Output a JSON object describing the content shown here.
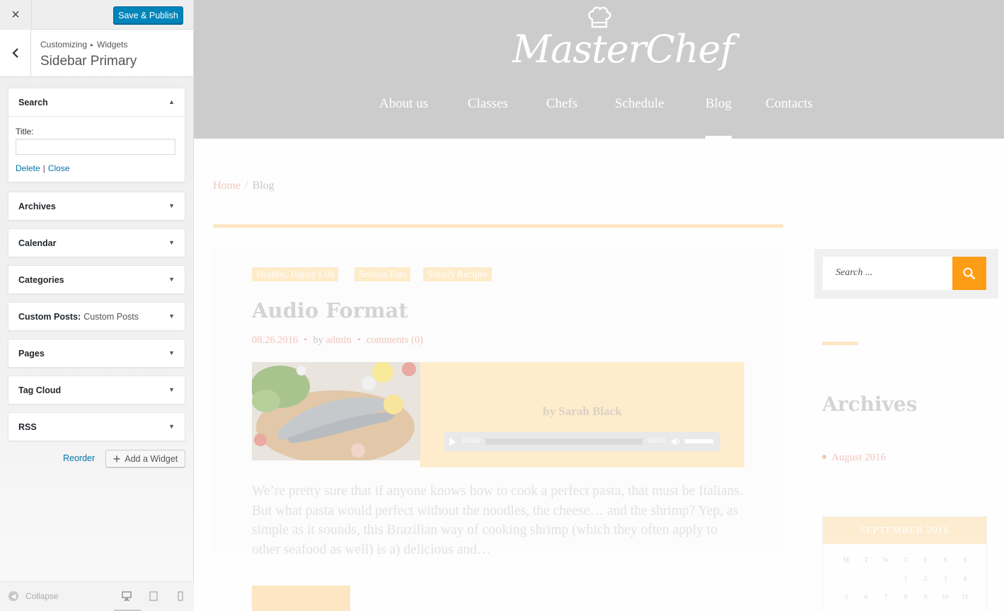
{
  "customizer": {
    "close_icon": "×",
    "save_label": "Save & Publish",
    "breadcrumb_parent": "Customizing",
    "breadcrumb_child": "Widgets",
    "breadcrumb_sep": "▸",
    "section_title": "Sidebar Primary",
    "back_icon": "‹",
    "open_widget": {
      "title": "Search",
      "title_label": "Title:",
      "title_value": "",
      "delete_label": "Delete",
      "close_label": "Close"
    },
    "widgets": [
      {
        "title": "Archives",
        "sub": ""
      },
      {
        "title": "Calendar",
        "sub": ""
      },
      {
        "title": "Categories",
        "sub": ""
      },
      {
        "title": "Custom Posts:",
        "sub": "Custom Posts"
      },
      {
        "title": "Pages",
        "sub": ""
      },
      {
        "title": "Tag Cloud",
        "sub": ""
      },
      {
        "title": "RSS",
        "sub": ""
      }
    ],
    "reorder_label": "Reorder",
    "add_widget_label": "Add a Widget",
    "collapse_label": "Collapse",
    "accent_color": "#0085ba",
    "link_color": "#0073aa"
  },
  "preview": {
    "site_name": "MasterChef",
    "nav": [
      "About us",
      "Classes",
      "Chefs",
      "Schedule",
      "Blog",
      "Contacts"
    ],
    "active_nav": "Blog",
    "breadcrumb": {
      "home": "Home",
      "sep": "/",
      "current": "Blog"
    },
    "post": {
      "tags": [
        "Healthy, Happy Life",
        "Serious Eats",
        "Simply Recipes"
      ],
      "title": "Audio Format",
      "date": "08.26.2016",
      "by": "by",
      "author": "admin",
      "comments": "comments (0)",
      "audio_by": "by Sarah Black",
      "player_current": "00:00",
      "player_total": "00:00",
      "excerpt": "We’re pretty sure that if anyone knows how to cook a perfect pasta, that must be Italians. But what pasta would perfect without the noodles, the cheese… and the shrimp? Yep, as simple as it sounds, this Brazilian way of cooking shrimp (which they often apply to other seafood as well) is a) delicious and…"
    },
    "sidebar": {
      "search_placeholder": "Search ...",
      "archives_title": "Archives",
      "archives": [
        "August 2016"
      ],
      "calendar_title": "SEPTEMBER 2016",
      "calendar_days": [
        "M",
        "T",
        "W",
        "T",
        "F",
        "S",
        "S"
      ],
      "calendar_rows": [
        [
          "",
          "",
          "",
          "1",
          "2",
          "3",
          "4"
        ],
        [
          "5",
          "6",
          "7",
          "8",
          "9",
          "10",
          "11"
        ]
      ]
    },
    "accent_orange": "#fd9d15",
    "header_bg": "#cccccc"
  }
}
